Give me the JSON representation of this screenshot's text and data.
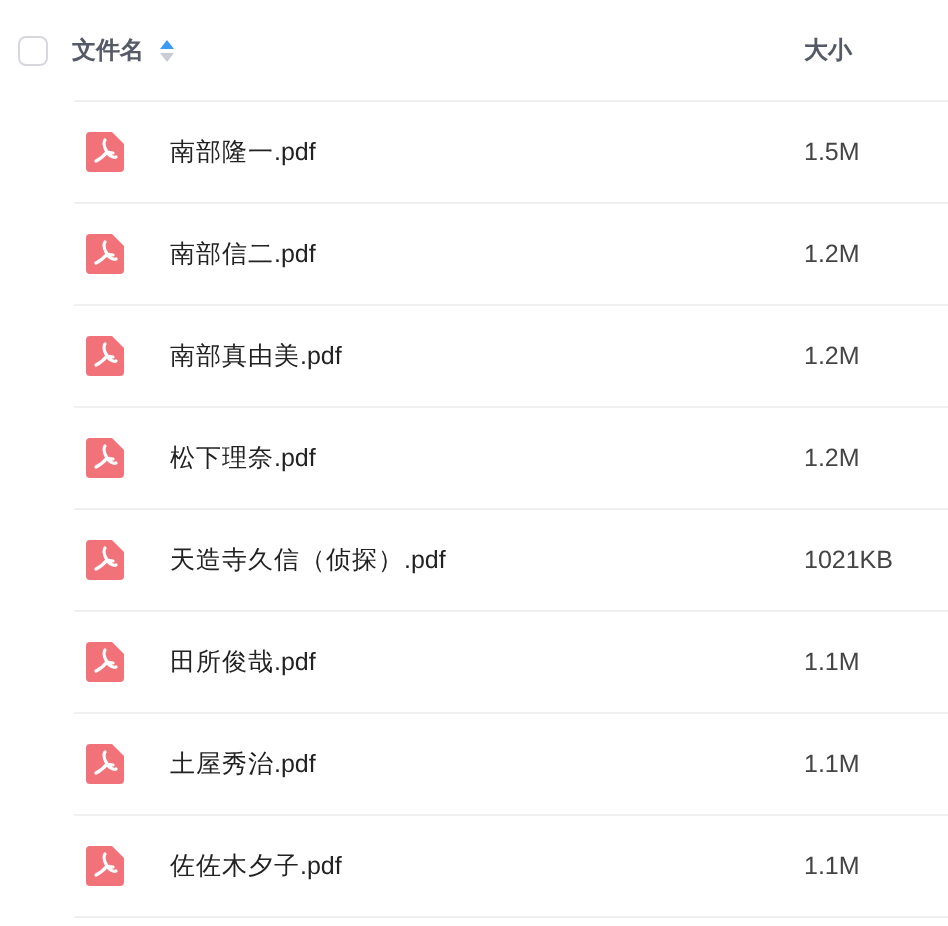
{
  "header": {
    "select_all_checked": false,
    "name_label": "文件名",
    "sort_ascending": true,
    "size_label": "大小"
  },
  "files": [
    {
      "name": "南部隆一.pdf",
      "size": "1.5M"
    },
    {
      "name": "南部信二.pdf",
      "size": "1.2M"
    },
    {
      "name": "南部真由美.pdf",
      "size": "1.2M"
    },
    {
      "name": "松下理奈.pdf",
      "size": "1.2M"
    },
    {
      "name": "天造寺久信（侦探）.pdf",
      "size": "1021KB"
    },
    {
      "name": "田所俊哉.pdf",
      "size": "1.1M"
    },
    {
      "name": "土屋秀治.pdf",
      "size": "1.1M"
    },
    {
      "name": "佐佐木夕子.pdf",
      "size": "1.1M"
    }
  ]
}
